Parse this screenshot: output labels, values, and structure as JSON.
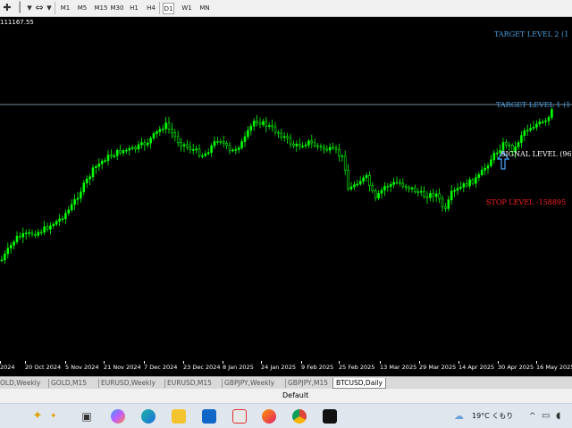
{
  "toolbar": {
    "timeframes": [
      {
        "label": "M1",
        "active": false
      },
      {
        "label": "M5",
        "active": false
      },
      {
        "label": "M15",
        "active": false
      },
      {
        "label": "M30",
        "active": false
      },
      {
        "label": "H1",
        "active": false
      },
      {
        "label": "H4",
        "active": false
      },
      {
        "label": "D1",
        "active": true
      },
      {
        "label": "W1",
        "active": false
      },
      {
        "label": "MN",
        "active": false
      }
    ]
  },
  "chart": {
    "price_header": "111167.55",
    "levels": {
      "target2": "TARGET LEVEL 2 (1",
      "target1": "TARGET LEVEL 1 (1",
      "signal": "SIGNAL LEVEL (96",
      "stop": "STOP LEVEL -158895"
    },
    "colors": {
      "background": "#000000",
      "candle": "#00ff00",
      "target": "#4a9fe0",
      "signal": "#ffffff",
      "stop": "#ff2020",
      "arrow": "#4aa8ff"
    },
    "x_labels": [
      "2024",
      "20 Oct 2024",
      "5 Nov 2024",
      "21 Nov 2024",
      "7 Dec 2024",
      "23 Dec 2024",
      "8 Jan 2025",
      "24 Jan 2025",
      "9 Feb 2025",
      "25 Feb 2025",
      "13 Mar 2025",
      "29 Mar 2025",
      "14 Apr 2025",
      "30 Apr 2025",
      "16 May 2025"
    ]
  },
  "tabs": [
    "OLD,Weekly",
    "GOLD,M15",
    "EURUSD,Weekly",
    "EURUSD,M15",
    "GBPJPY,Weekly",
    "GBPJPY,M15",
    "BTCUSD,Daily"
  ],
  "active_tab": "BTCUSD,Daily",
  "status": {
    "profile": "Default"
  },
  "taskbar": {
    "weather": "19°C くもり"
  }
}
